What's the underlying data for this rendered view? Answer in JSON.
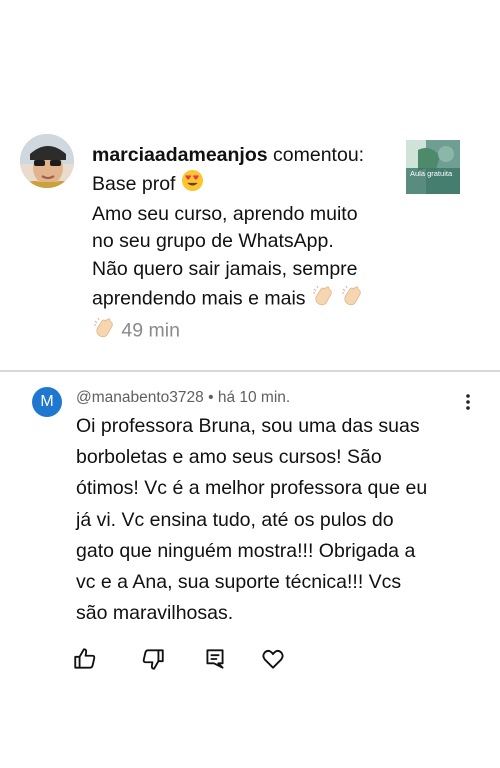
{
  "instagram_comment": {
    "username": "marciaadameanjos",
    "action_text": "comentou:",
    "lines": [
      "Base prof",
      "Amo seu curso, aprendo muito",
      "no seu grupo de WhatsApp.",
      "Não quero sair jamais, sempre",
      "aprendendo mais e mais"
    ],
    "emojis": [
      "heart-eyes-emoji",
      "clapping-hands-emoji",
      "clapping-hands-emoji",
      "clapping-hands-emoji"
    ],
    "time": "49 min",
    "thumbnail": {
      "title": "Aula gratuita"
    }
  },
  "youtube_comment": {
    "avatar_letter": "M",
    "avatar_color": "#1f77d0",
    "author": "@manabento3728",
    "separator": " • ",
    "time": "há 10 min.",
    "lines": [
      "Oi professora Bruna, sou uma das suas",
      "borboletas e amo seus cursos! São",
      "ótimos! Vc é a melhor professora que eu",
      "já vi. Vc ensina tudo, até os pulos do",
      "gato que ninguém mostra!!! Obrigada a",
      "vc e a Ana, sua suporte técnica!!! Vcs",
      "são maravilhosas."
    ],
    "actions": [
      "like-icon",
      "dislike-icon",
      "reply-icon",
      "heart-icon",
      "more-icon"
    ]
  }
}
